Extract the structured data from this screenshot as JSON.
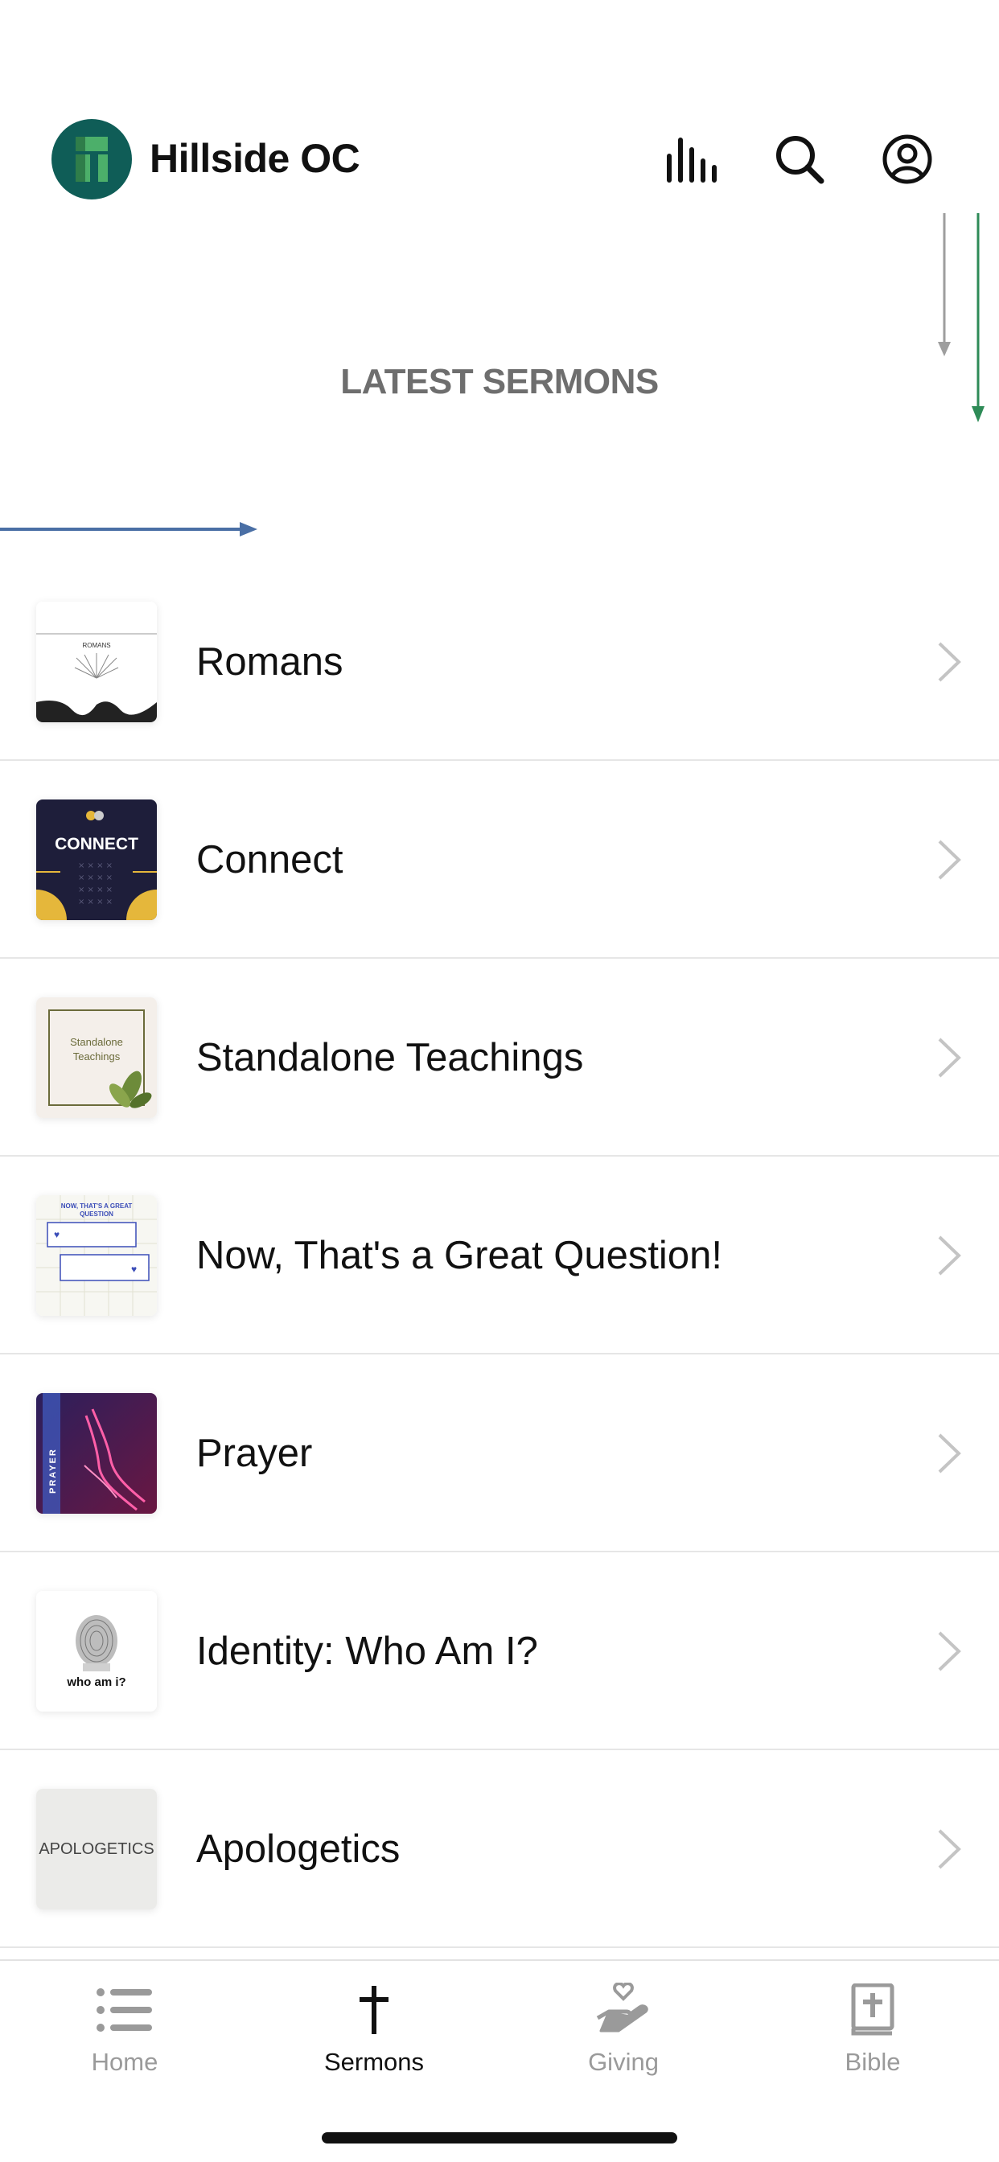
{
  "app": {
    "title": "Hillside OC"
  },
  "header": {
    "icons": [
      "bar-chart-icon",
      "search-icon",
      "profile-icon"
    ]
  },
  "hero": {
    "title": "LATEST SERMONS"
  },
  "series": [
    {
      "label": "Romans",
      "thumb_text": "ROMANS"
    },
    {
      "label": "Connect",
      "thumb_text": "CONNECT"
    },
    {
      "label": "Standalone Teachings",
      "thumb_text": "Standalone Teachings"
    },
    {
      "label": "Now, That's a Great Question!",
      "thumb_text": "NOW, THAT'S A GREAT QUESTION"
    },
    {
      "label": "Prayer",
      "thumb_text": "PRAYER"
    },
    {
      "label": "Identity: Who Am I?",
      "thumb_text": "who am i?"
    },
    {
      "label": "Apologetics",
      "thumb_text": "APOLOGETICS"
    }
  ],
  "tabbar": {
    "tabs": [
      {
        "label": "Home",
        "icon": "list-icon",
        "active": false
      },
      {
        "label": "Sermons",
        "icon": "cross-icon",
        "active": true
      },
      {
        "label": "Giving",
        "icon": "giving-hand-icon",
        "active": false
      },
      {
        "label": "Bible",
        "icon": "bible-icon",
        "active": false
      }
    ]
  },
  "colors": {
    "brand": "#0f5d57",
    "brand_light": "#2e8b57",
    "hero_title": "#6e6e6e",
    "active_tab": "#111111",
    "inactive_tab": "#9a9a9a"
  }
}
